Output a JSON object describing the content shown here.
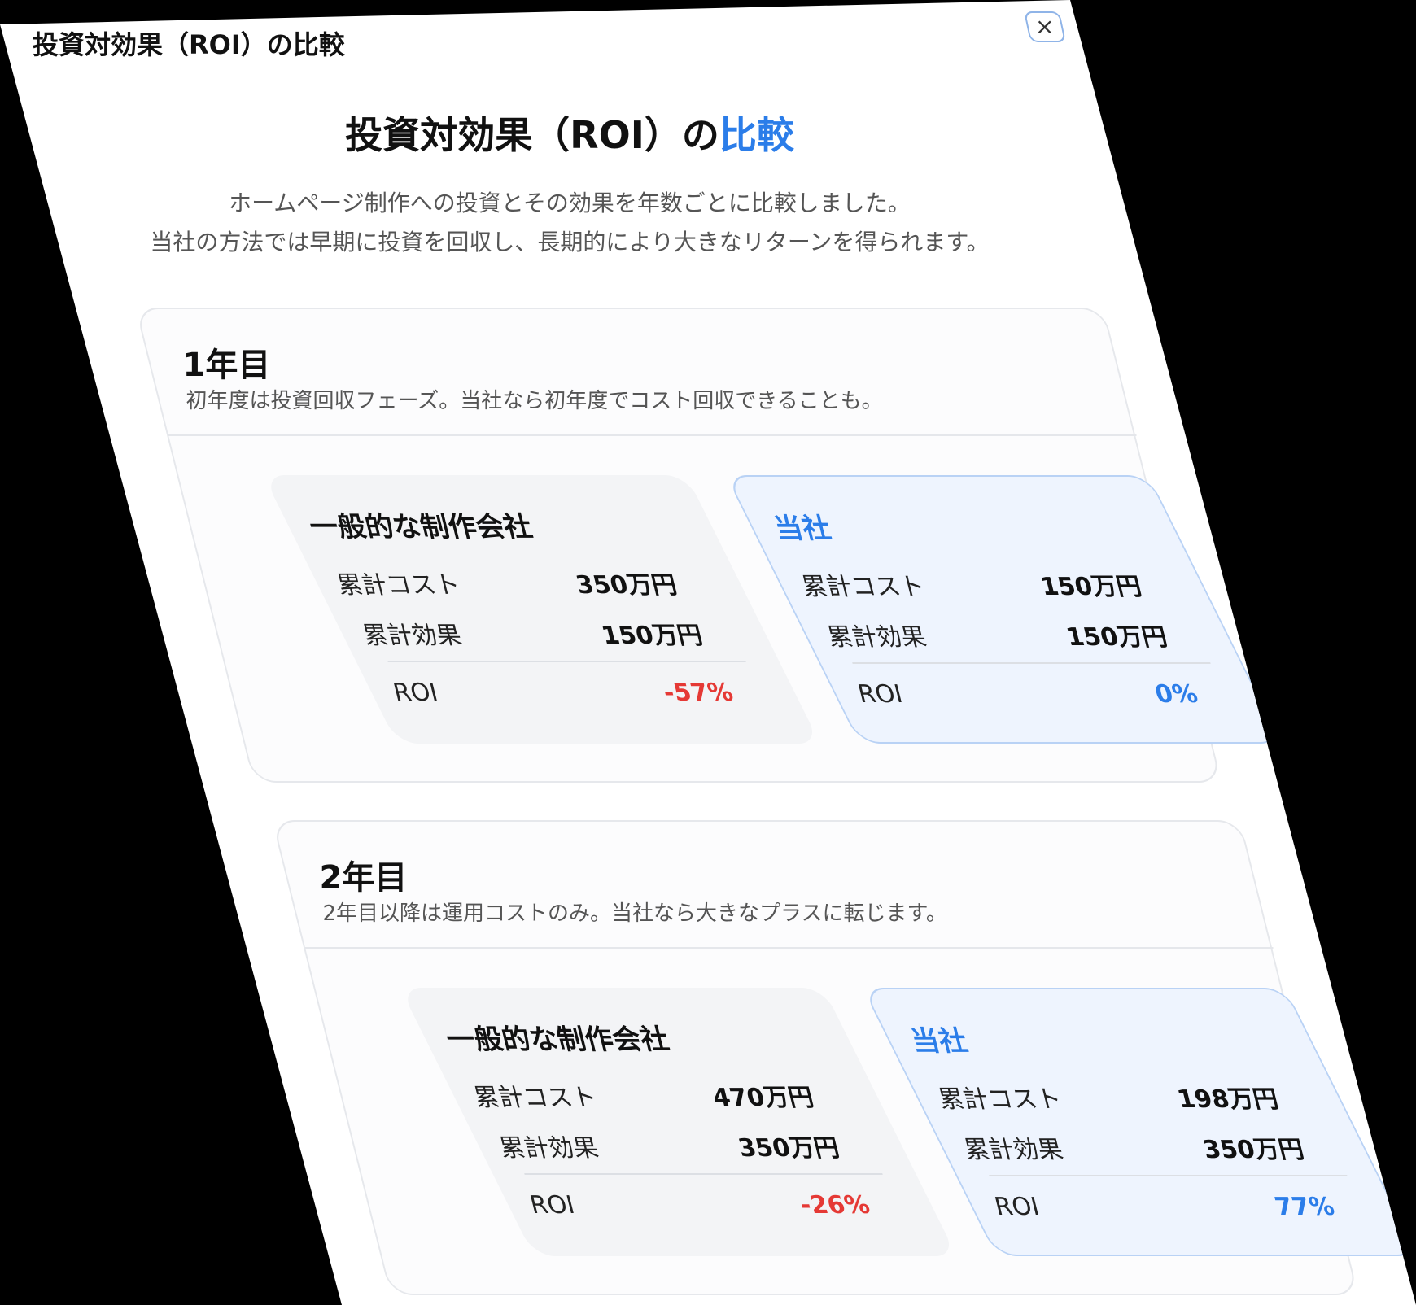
{
  "header": {
    "title": "投資対効果（ROI）の比較",
    "close_icon": "×"
  },
  "main": {
    "title_prefix": "投資対効果（ROI）の",
    "title_accent": "比較",
    "description_line1": "ホームページ制作への投資とその効果を年数ごとに比較しました。",
    "description_line2": "当社の方法では早期に投資を回収し、長期的により大きなリターンを得られます。"
  },
  "years": [
    {
      "heading": "1年目",
      "subtitle": "初年度は投資回収フェーズ。当社なら初年度でコスト回収できることも。",
      "other": {
        "title": "一般的な制作会社",
        "cost_label": "累計コスト",
        "cost": "350万円",
        "effect_label": "累計効果",
        "effect": "150万円",
        "roi_label": "ROI",
        "roi": "-57%"
      },
      "ours": {
        "title": "当社",
        "cost_label": "累計コスト",
        "cost": "150万円",
        "effect_label": "累計効果",
        "effect": "150万円",
        "roi_label": "ROI",
        "roi": "0%"
      }
    },
    {
      "heading": "2年目",
      "subtitle": "2年目以降は運用コストのみ。当社なら大きなプラスに転じます。",
      "other": {
        "title": "一般的な制作会社",
        "cost_label": "累計コスト",
        "cost": "470万円",
        "effect_label": "累計効果",
        "effect": "350万円",
        "roi_label": "ROI",
        "roi": "-26%"
      },
      "ours": {
        "title": "当社",
        "cost_label": "累計コスト",
        "cost": "198万円",
        "effect_label": "累計効果",
        "effect": "350万円",
        "roi_label": "ROI",
        "roi": "77%"
      }
    }
  ],
  "colors": {
    "accent": "#2b7de9",
    "negative": "#e53935"
  }
}
